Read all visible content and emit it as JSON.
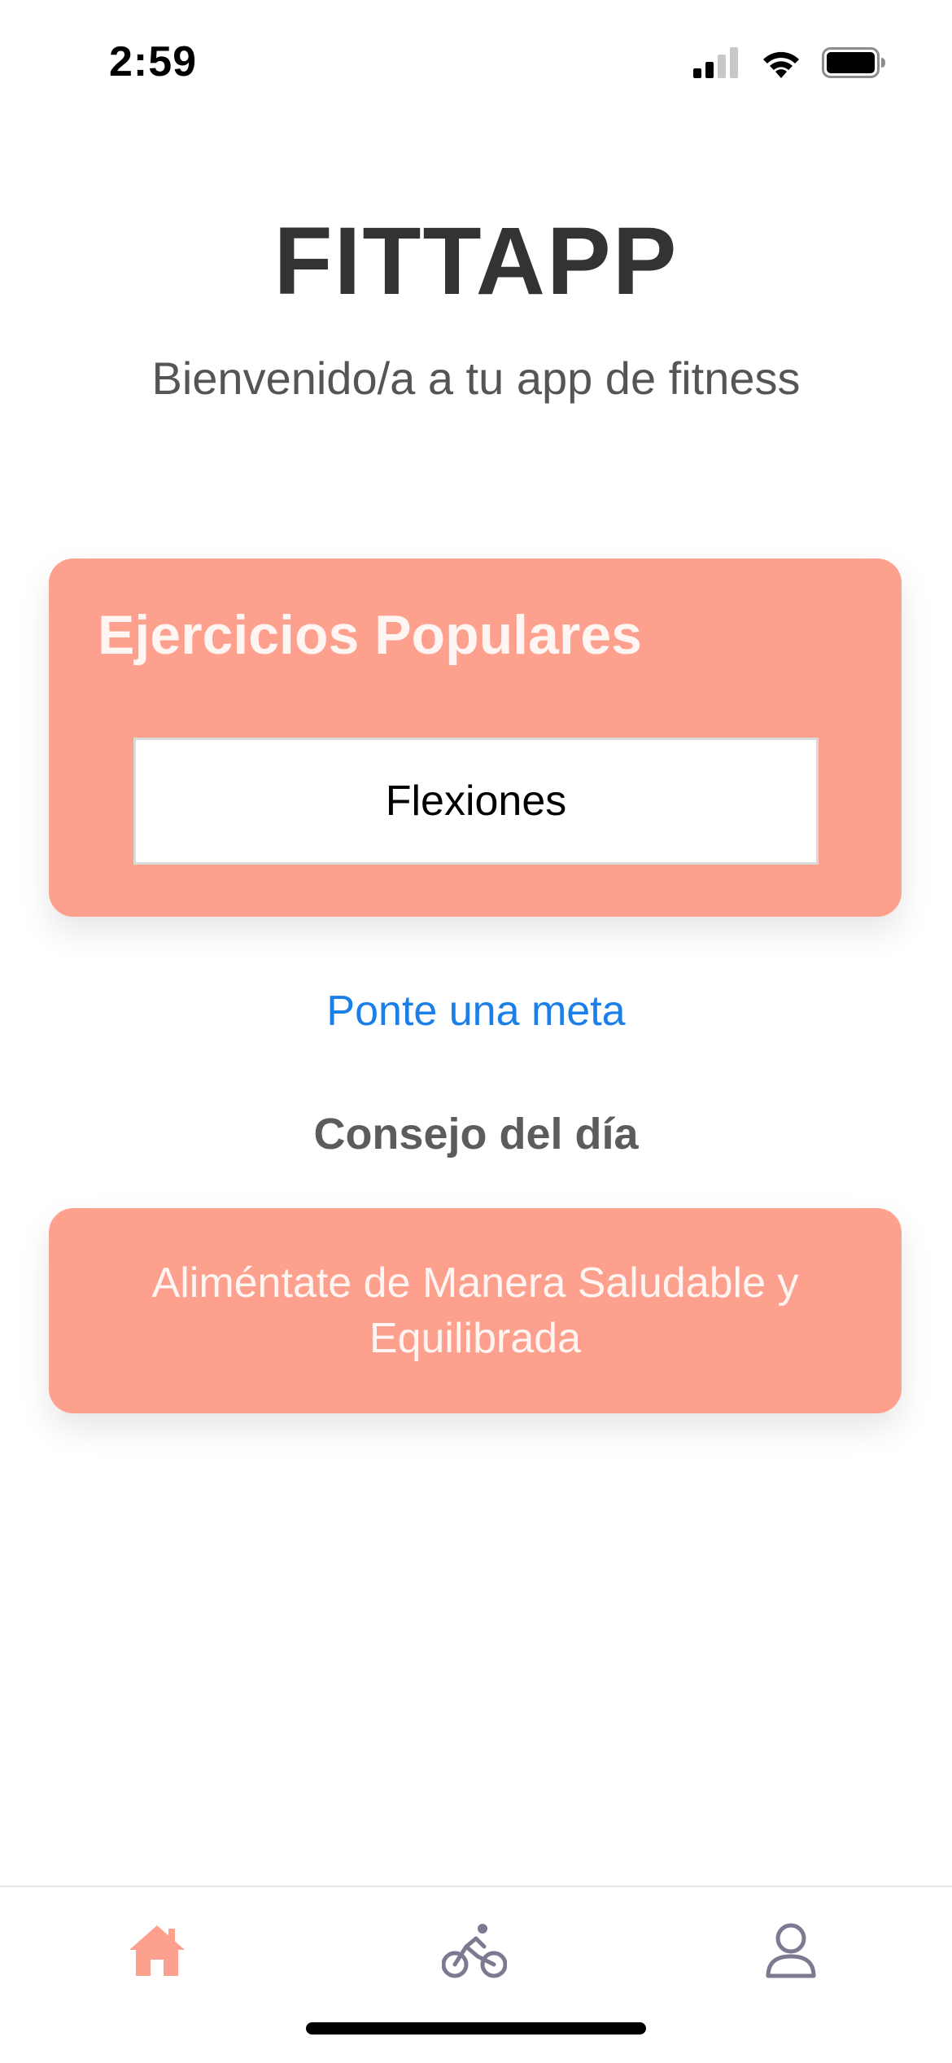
{
  "status_bar": {
    "time": "2:59"
  },
  "header": {
    "title": "FITTAPP",
    "subtitle": "Bienvenido/a a tu app de fitness"
  },
  "popular": {
    "heading": "Ejercicios Populares",
    "items": [
      "Flexiones"
    ]
  },
  "goal_link": "Ponte una meta",
  "tip": {
    "heading": "Consejo del día",
    "text": "Aliméntate de Manera Saludable y Equilibrada"
  },
  "tab_bar": {
    "tabs": [
      {
        "icon": "home-icon",
        "active": true
      },
      {
        "icon": "bicycle-icon",
        "active": false
      },
      {
        "icon": "person-icon",
        "active": false
      }
    ],
    "active_color": "#fea08e",
    "inactive_color": "#7b7a90"
  },
  "colors": {
    "accent": "#fea08e",
    "link": "#1a7fe8",
    "title": "#333333"
  }
}
